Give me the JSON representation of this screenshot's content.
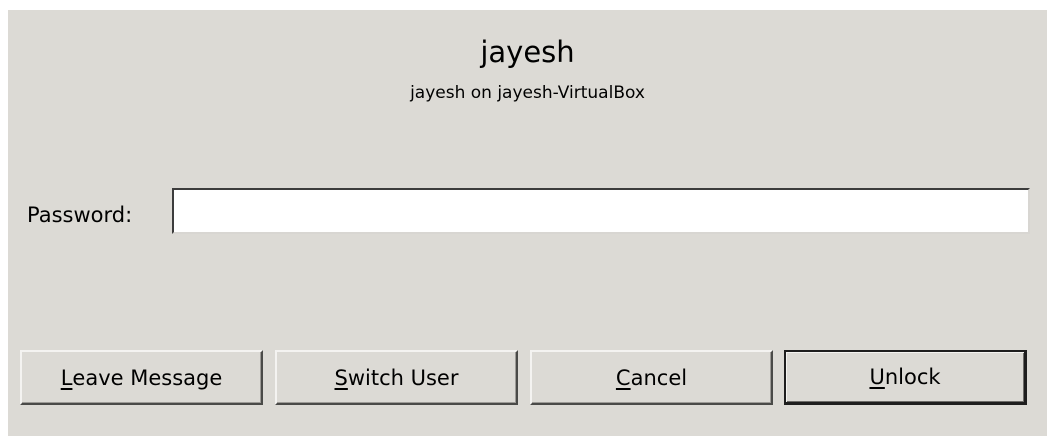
{
  "header": {
    "title": "jayesh",
    "subtitle": "jayesh on jayesh-VirtualBox"
  },
  "password": {
    "label": "Password:",
    "value": "",
    "placeholder": ""
  },
  "buttons": {
    "leave_message": {
      "mnemonic": "L",
      "rest": "eave Message"
    },
    "switch_user": {
      "mnemonic": "S",
      "rest": "witch User"
    },
    "cancel": {
      "mnemonic": "C",
      "rest": "ancel"
    },
    "unlock": {
      "mnemonic": "U",
      "rest": "nlock"
    }
  },
  "colors": {
    "dialog_background": "#dcdad5",
    "input_background": "#ffffff"
  }
}
